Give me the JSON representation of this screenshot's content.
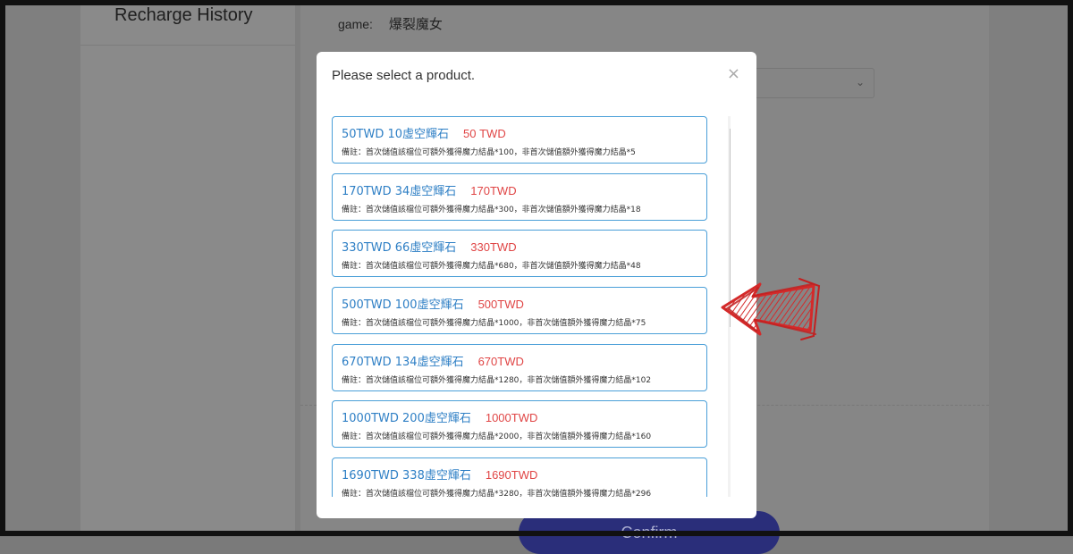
{
  "sidebar": {
    "title": "Recharge History"
  },
  "form": {
    "game_label": "game:",
    "game_value": "爆裂魔女",
    "confirm_label": "Confirm"
  },
  "modal": {
    "title": "Please select a product.",
    "close_glyph": "×",
    "products": [
      {
        "name": "50TWD 10虛空輝石",
        "price": "50 TWD",
        "note": "備註：首次儲值該檔位可額外獲得魔力結晶*100，非首次儲值額外獲得魔力結晶*5"
      },
      {
        "name": "170TWD 34虛空輝石",
        "price": "170TWD",
        "note": "備註：首次儲值該檔位可額外獲得魔力結晶*300，非首次儲值額外獲得魔力結晶*18"
      },
      {
        "name": "330TWD 66虛空輝石",
        "price": "330TWD",
        "note": "備註：首次儲值該檔位可額外獲得魔力結晶*680，非首次儲值額外獲得魔力結晶*48"
      },
      {
        "name": "500TWD 100虛空輝石",
        "price": "500TWD",
        "note": "備註：首次儲值該檔位可額外獲得魔力結晶*1000，非首次儲值額外獲得魔力結晶*75"
      },
      {
        "name": "670TWD 134虛空輝石",
        "price": "670TWD",
        "note": "備註：首次儲值該檔位可額外獲得魔力結晶*1280，非首次儲值額外獲得魔力結晶*102"
      },
      {
        "name": "1000TWD 200虛空輝石",
        "price": "1000TWD",
        "note": "備註：首次儲值該檔位可額外獲得魔力結晶*2000，非首次儲值額外獲得魔力結晶*160"
      },
      {
        "name": "1690TWD 338虛空輝石",
        "price": "1690TWD",
        "note": "備註：首次儲值該檔位可額外獲得魔力結晶*3280，非首次儲值額外獲得魔力結晶*296"
      }
    ]
  },
  "icons": {
    "close": "close-icon",
    "chevron": "chevron-down-icon",
    "scroll_up": "scroll-up-arrow-icon",
    "scroll_down": "scroll-down-arrow-icon",
    "annotation": "red-arrow-annotation-icon"
  },
  "colors": {
    "product_name": "#2e7fc5",
    "product_price": "#e04545",
    "card_border": "#4a9fd8",
    "annotation": "#d42a2a",
    "overlay": "#7f7f7f"
  }
}
